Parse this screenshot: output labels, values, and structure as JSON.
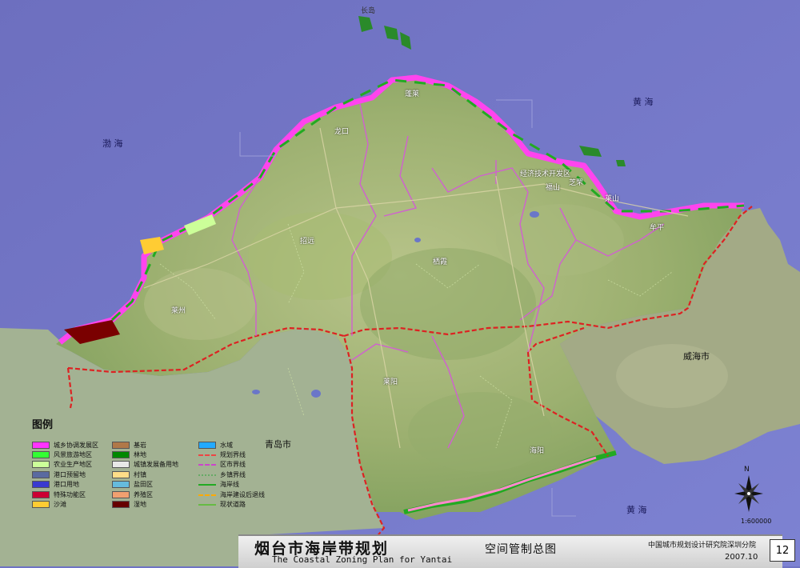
{
  "map": {
    "title_cn": "烟台市海岸带规划",
    "title_en": "The Coastal Zoning Plan for Yantai",
    "subtitle": "空间管制总图",
    "institute": "中国城市规划设计研究院深圳分院",
    "date": "2007.10",
    "page_number": "12",
    "scale": "1:600000",
    "north_label": "N"
  },
  "seas": {
    "bohai": "渤 海",
    "huanghai_north": "黄 海",
    "huanghai_south": "黄 海"
  },
  "cities": {
    "weihai": "威海市",
    "qingdao": "青岛市"
  },
  "places": {
    "changdao": "长岛",
    "penglai": "蓬莱",
    "longkou": "龙口",
    "kaifaqu": "经济技术开发区",
    "fushan": "福山",
    "zhifu": "芝罘",
    "laishan": "莱山",
    "muping": "牟平",
    "zhaoyuan": "招远",
    "qixia": "栖霞",
    "laizhou": "莱州",
    "laiyang": "莱阳",
    "haiyang": "海阳"
  },
  "legend": {
    "title": "图例",
    "col1": [
      {
        "label": "城乡协调发展区",
        "color": "#ff33ff"
      },
      {
        "label": "风景旅游地区",
        "color": "#33ff33"
      },
      {
        "label": "农业生产地区",
        "color": "#ccff99"
      },
      {
        "label": "港口预留地",
        "color": "#5a6aa0"
      },
      {
        "label": "港口用地",
        "color": "#3a3ad0"
      },
      {
        "label": "特殊功能区",
        "color": "#cc0033"
      },
      {
        "label": "沙滩",
        "color": "#ffcc33"
      }
    ],
    "col2": [
      {
        "label": "基岩",
        "color": "#b07848"
      },
      {
        "label": "林地",
        "color": "#008800"
      },
      {
        "label": "城镇发展备用地",
        "color": "#e8e8e8"
      },
      {
        "label": "村镇",
        "color": "#ffdd88"
      },
      {
        "label": "盐田区",
        "color": "#66bbdd"
      },
      {
        "label": "养殖区",
        "color": "#f0a070"
      },
      {
        "label": "湿地",
        "color": "#660000"
      }
    ],
    "col3": [
      {
        "label": "水域",
        "color": "#22aaff",
        "kind": "area"
      },
      {
        "label": "规划界线",
        "color": "#ee4444",
        "kind": "dashed"
      },
      {
        "label": "区市界线",
        "color": "#cc44cc",
        "kind": "dashed"
      },
      {
        "label": "乡镇界线",
        "color": "#66aa66",
        "kind": "dotted"
      },
      {
        "label": "海岸线",
        "color": "#22aa22",
        "kind": "solid"
      },
      {
        "label": "海岸建设后退线",
        "color": "#ffaa00",
        "kind": "dashed"
      },
      {
        "label": "现状道路",
        "color": "#66bb44",
        "kind": "solid"
      }
    ]
  },
  "colors": {
    "sea": "#7478c8",
    "land": "#9fb46c",
    "coast_pink": "#ff55ee",
    "boundary_red": "#dd2222",
    "boundary_pink": "#dd66dd"
  }
}
